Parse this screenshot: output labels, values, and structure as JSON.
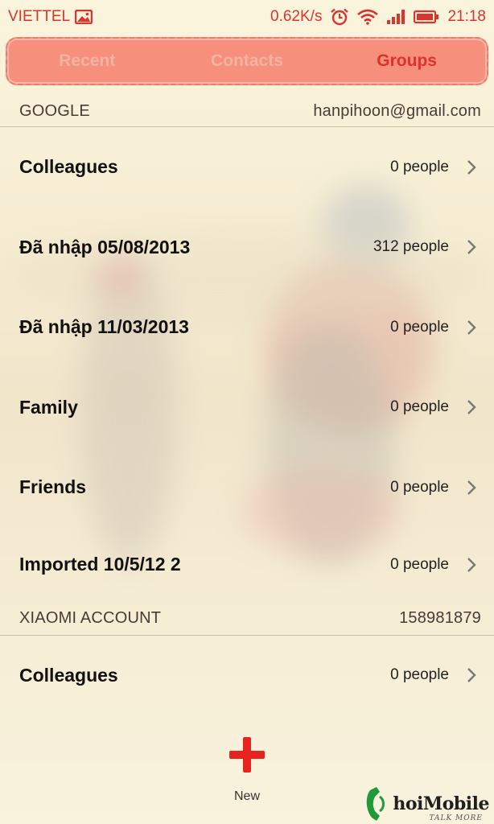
{
  "status_bar": {
    "carrier": "VIETTEL",
    "speed": "0.62K/s",
    "time": "21:18",
    "icons": [
      "gallery-icon",
      "alarm-icon",
      "wifi-icon",
      "signal-icon",
      "battery-icon"
    ],
    "color": "#d9352c"
  },
  "tabs": [
    {
      "label": "Recent",
      "active": false
    },
    {
      "label": "Contacts",
      "active": false
    },
    {
      "label": "Groups",
      "active": true
    }
  ],
  "sections": [
    {
      "title": "GOOGLE",
      "account": "hanpihoon@gmail.com",
      "groups": [
        {
          "name": "Colleagues",
          "count": "0 people"
        },
        {
          "name": "Đã nhập 05/08/2013",
          "count": "312 people"
        },
        {
          "name": "Đã nhập 11/03/2013",
          "count": "0 people"
        },
        {
          "name": "Family",
          "count": "0 people"
        },
        {
          "name": "Friends",
          "count": "0 people"
        },
        {
          "name": "Imported 10/5/12 2",
          "count": "0 people"
        }
      ]
    },
    {
      "title": "XIAOMI ACCOUNT",
      "account": "158981879",
      "groups": [
        {
          "name": "Colleagues",
          "count": "0 people"
        }
      ]
    }
  ],
  "new_button": {
    "label": "New",
    "icon": "plus-icon",
    "color": "#e8221e"
  },
  "watermark": {
    "text": "hoiMobile",
    "tagline": "TALK MORE"
  },
  "colors": {
    "accent": "#e0312a",
    "tab_bg": "#f6907c",
    "tab_inactive": "#f4b3a2"
  }
}
